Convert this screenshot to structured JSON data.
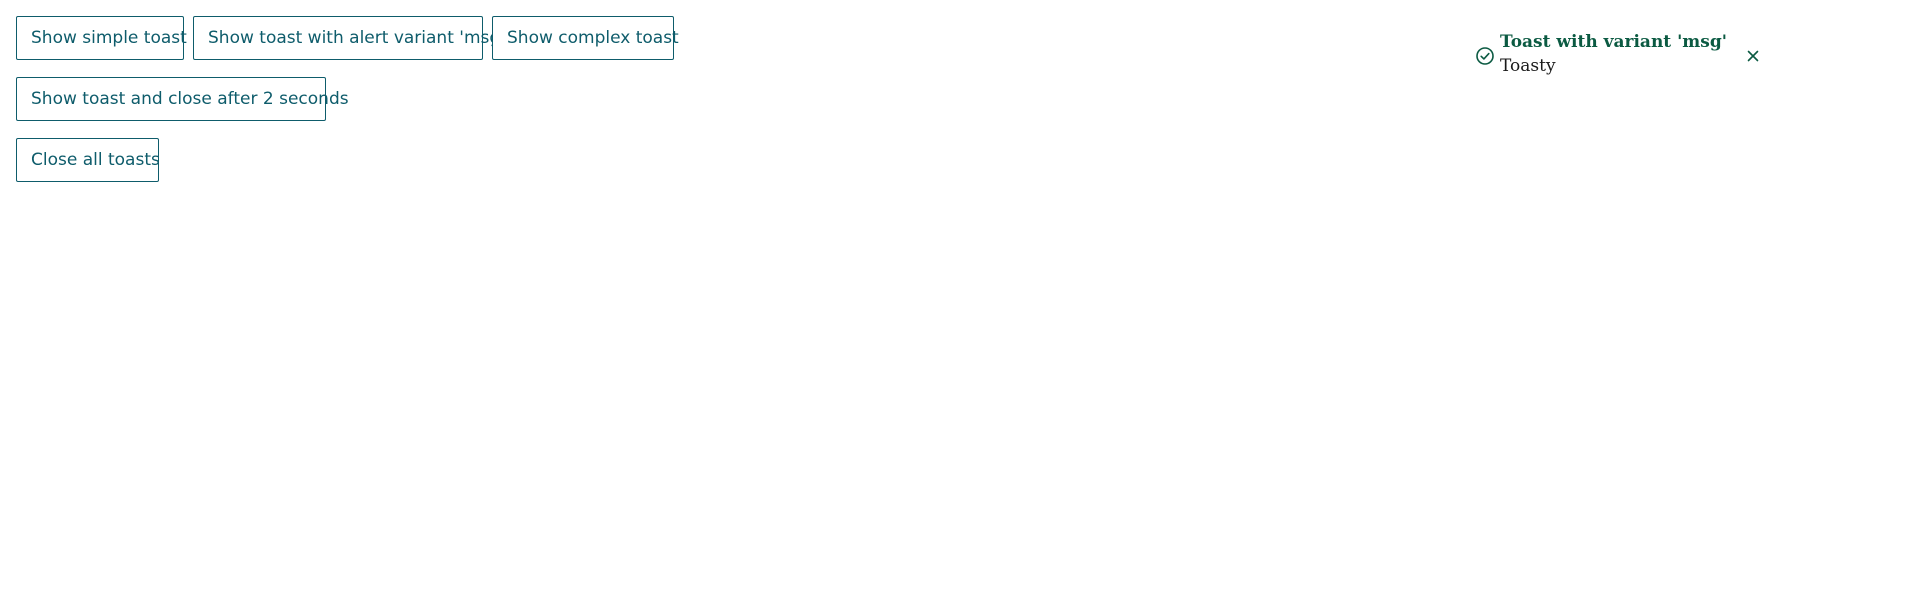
{
  "buttons": {
    "simple": "Show simple toast",
    "alert_variant": "Show toast with alert variant 'msg'",
    "complex": "Show complex toast",
    "close_after_2s": "Show toast and close after 2 seconds",
    "close_all": "Close all toasts"
  },
  "toast": {
    "title": "Toast with variant 'msg'",
    "body": "Toasty",
    "icon": "check-circle-icon",
    "close_icon": "close-icon"
  },
  "colors": {
    "button_border": "#0e5c6b",
    "button_text": "#0e5c6b",
    "toast_title": "#0b5a42",
    "toast_icon": "#0b5a42"
  }
}
